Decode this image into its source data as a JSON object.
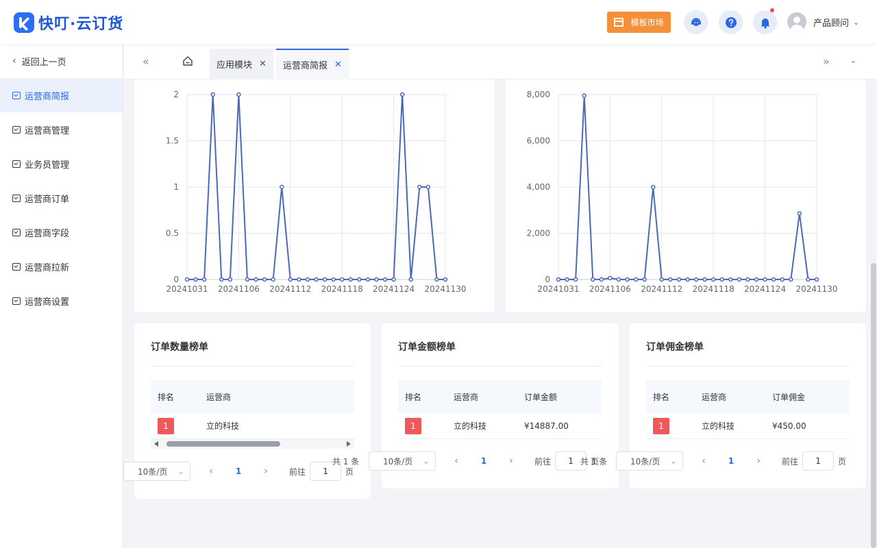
{
  "header": {
    "app_title": "快叮·云订货",
    "template_market_label": "模板市场",
    "user_name": "产品顾问",
    "icons": [
      "customer-service-icon",
      "help-icon",
      "bell-icon"
    ],
    "accent_color": "#2b66e3",
    "brand_orange": "#f5903a"
  },
  "sidebar": {
    "back_label": "返回上一页",
    "items": [
      {
        "label": "运营商简报",
        "active": true
      },
      {
        "label": "运营商管理"
      },
      {
        "label": "业务员管理"
      },
      {
        "label": "运营商订单"
      },
      {
        "label": "运营商字段"
      },
      {
        "label": "运营商拉新"
      },
      {
        "label": "运营商设置"
      }
    ]
  },
  "tabs": [
    {
      "label": "应用模块",
      "active": false
    },
    {
      "label": "运营商简报",
      "active": true
    }
  ],
  "chart_data": [
    {
      "type": "line",
      "x": [
        "20241031",
        "20241101",
        "20241102",
        "20241103",
        "20241104",
        "20241105",
        "20241106",
        "20241107",
        "20241108",
        "20241109",
        "20241110",
        "20241111",
        "20241112",
        "20241113",
        "20241114",
        "20241115",
        "20241116",
        "20241117",
        "20241118",
        "20241119",
        "20241120",
        "20241121",
        "20241122",
        "20241123",
        "20241124",
        "20241125",
        "20241126",
        "20241127",
        "20241128",
        "20241129",
        "20241130"
      ],
      "xticks": [
        "20241031",
        "20241106",
        "20241112",
        "20241118",
        "20241124",
        "20241130"
      ],
      "series": [
        {
          "values": [
            0,
            0,
            0,
            2,
            0,
            0,
            2,
            0,
            0,
            0,
            0,
            1,
            0,
            0,
            0,
            0,
            0,
            0,
            0,
            0,
            0,
            0,
            0,
            0,
            0,
            2,
            0,
            1,
            1,
            0,
            0
          ]
        }
      ],
      "yticks": [
        "0",
        "0.5",
        "1",
        "1.5",
        "2"
      ],
      "ylim": [
        0,
        2
      ],
      "color": "#4a68b8",
      "grid": true
    },
    {
      "type": "line",
      "x": [
        "20241031",
        "20241101",
        "20241102",
        "20241103",
        "20241104",
        "20241105",
        "20241106",
        "20241107",
        "20241108",
        "20241109",
        "20241110",
        "20241111",
        "20241112",
        "20241113",
        "20241114",
        "20241115",
        "20241116",
        "20241117",
        "20241118",
        "20241119",
        "20241120",
        "20241121",
        "20241122",
        "20241123",
        "20241124",
        "20241125",
        "20241126",
        "20241127",
        "20241128",
        "20241129",
        "20241130"
      ],
      "xticks": [
        "20241031",
        "20241106",
        "20241112",
        "20241118",
        "20241124",
        "20241130"
      ],
      "series": [
        {
          "values": [
            0,
            0,
            0,
            7950,
            0,
            0,
            60,
            0,
            0,
            0,
            0,
            3990,
            0,
            0,
            0,
            0,
            0,
            0,
            0,
            0,
            0,
            0,
            0,
            0,
            0,
            0,
            0,
            0,
            2860,
            0,
            0
          ]
        }
      ],
      "yticks": [
        "0",
        "2,000",
        "4,000",
        "6,000",
        "8,000"
      ],
      "ylim": [
        0,
        8000
      ],
      "color": "#4a68b8",
      "grid": true
    }
  ],
  "rankings": [
    {
      "title": "订单数量榜单",
      "headers": [
        "排名",
        "运营商"
      ],
      "rows": [
        {
          "rank": "1",
          "operator": "立的科技"
        }
      ],
      "page_size": "10条/页",
      "current_page": "1",
      "goto_label": "前往",
      "goto_value": "1",
      "page_suffix": "页"
    },
    {
      "title": "订单金额榜单",
      "headers": [
        "排名",
        "运营商",
        "订单金额"
      ],
      "rows": [
        {
          "rank": "1",
          "operator": "立的科技",
          "value": "¥14887.00"
        }
      ],
      "total": "共 1 条",
      "page_size": "10条/页",
      "current_page": "1",
      "goto_label": "前往",
      "goto_value": "1",
      "page_suffix": "页"
    },
    {
      "title": "订单佣金榜单",
      "headers": [
        "排名",
        "运营商",
        "订单佣金"
      ],
      "rows": [
        {
          "rank": "1",
          "operator": "立的科技",
          "value": "¥450.00"
        }
      ],
      "total": "共 1 条",
      "page_size": "10条/页",
      "current_page": "1",
      "goto_label": "前往",
      "goto_value": "1",
      "page_suffix": "页"
    }
  ]
}
